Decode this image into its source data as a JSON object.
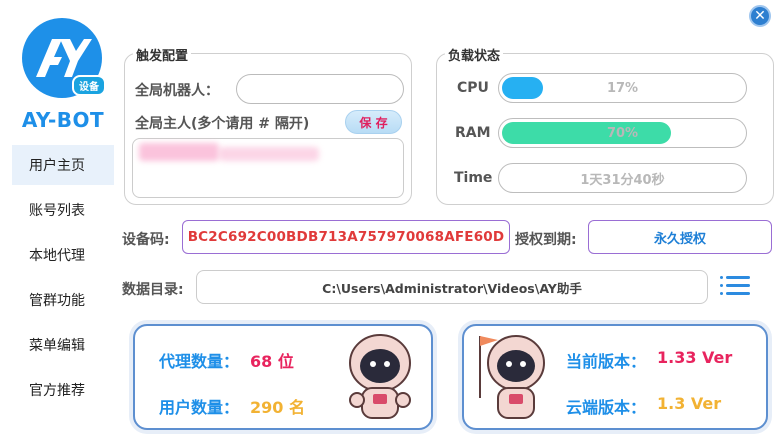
{
  "brand": {
    "logo_text": "AY",
    "badge": "设备",
    "name": "AY-BOT"
  },
  "nav": {
    "items": [
      {
        "label": "用户主页",
        "active": true
      },
      {
        "label": "账号列表",
        "active": false
      },
      {
        "label": "本地代理",
        "active": false
      },
      {
        "label": "管群功能",
        "active": false
      },
      {
        "label": "菜单编辑",
        "active": false
      },
      {
        "label": "官方推荐",
        "active": false
      }
    ]
  },
  "trigger": {
    "title": "触发配置",
    "robot_label": "全局机器人：",
    "robot_value": "",
    "owner_label": "全局主人(多个请用 # 隔开)",
    "save_label": "保 存",
    "owner_value": ""
  },
  "load": {
    "title": "负载状态",
    "cpu_label": "CPU",
    "cpu_text": "17%",
    "cpu_level": 17,
    "ram_label": "RAM",
    "ram_text": "70%",
    "ram_level": 70,
    "time_label": "Time",
    "time_text": "1天31分40秒"
  },
  "device": {
    "code_label": "设备码:",
    "code_value": "BC2C692C00BDB713A757970068AFE60D",
    "expiry_label": "授权到期:",
    "expiry_value": "永久授权",
    "dir_label": "数据目录:",
    "dir_value": "C:\\Users\\Administrator\\Videos\\AY助手"
  },
  "stats": {
    "proxy_label": "代理数量：",
    "proxy_value": "68 位",
    "user_label": "用户数量：",
    "user_value": "290 名",
    "current_version_label": "当前版本：",
    "current_version_value": "1.33 Ver",
    "cloud_version_label": "云端版本：",
    "cloud_version_value": "1.3 Ver"
  },
  "colors": {
    "accent": "#1e8fe8",
    "cpu_fill": "#26b0f2",
    "ram_fill": "#3ddca8",
    "highlight_red": "#e8245e",
    "highlight_orange": "#f2b233"
  },
  "icons": {
    "close": "close-icon",
    "menu": "list-menu-icon",
    "mascot": "astronaut-mascot"
  }
}
